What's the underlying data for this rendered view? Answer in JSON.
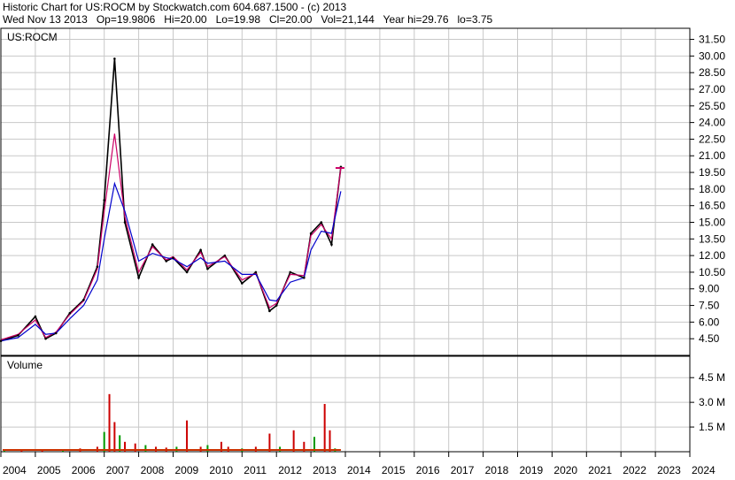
{
  "header": {
    "title_line": "Historic Chart for US:ROCM by Stockwatch.com 604.687.1500 - (c) 2013",
    "stats_line": "Wed Nov 13 2013   Op=19.9806   Hi=20.00   Lo=19.98   Cl=20.00   Vol=21,144   Year hi=29.76   lo=3.75"
  },
  "chart_data": [
    {
      "type": "line",
      "label": "US:ROCM",
      "ylim": [
        3.0,
        32.5
      ],
      "yticks": [
        "31.50",
        "30.00",
        "28.50",
        "27.00",
        "25.50",
        "24.00",
        "22.50",
        "21.00",
        "19.50",
        "18.00",
        "16.50",
        "15.00",
        "13.50",
        "12.00",
        "10.50",
        "9.00",
        "7.50",
        "6.00",
        "4.50"
      ],
      "x": [
        "2004.0",
        "2004.5",
        "2005.0",
        "2005.3",
        "2005.6",
        "2006.0",
        "2006.4",
        "2006.8",
        "2007.0",
        "2007.3",
        "2007.6",
        "2008.0",
        "2008.4",
        "2008.8",
        "2009.0",
        "2009.4",
        "2009.8",
        "2010.0",
        "2010.5",
        "2011.0",
        "2011.4",
        "2011.8",
        "2012.0",
        "2012.4",
        "2012.8",
        "2013.0",
        "2013.3",
        "2013.6",
        "2013.87"
      ],
      "series": [
        {
          "color": "#000000",
          "values": [
            4.3,
            4.8,
            6.5,
            4.5,
            5.0,
            6.8,
            8.0,
            11.0,
            17.0,
            29.76,
            15.0,
            10.0,
            13.0,
            11.5,
            11.8,
            10.5,
            12.5,
            10.8,
            12.0,
            9.5,
            10.5,
            7.0,
            7.5,
            10.5,
            10.0,
            14.0,
            15.0,
            13.0,
            20.0
          ]
        },
        {
          "color": "#cc0066",
          "values": [
            4.4,
            4.9,
            6.2,
            4.6,
            5.1,
            6.7,
            7.9,
            10.8,
            16.0,
            23.0,
            15.5,
            10.5,
            12.8,
            11.6,
            11.9,
            10.7,
            12.3,
            11.0,
            11.9,
            9.8,
            10.4,
            7.3,
            7.7,
            10.3,
            10.2,
            13.8,
            14.8,
            13.5,
            19.9
          ]
        },
        {
          "color": "#0000cc",
          "values": [
            4.3,
            4.6,
            5.8,
            4.9,
            5.0,
            6.3,
            7.5,
            9.8,
            13.5,
            18.5,
            16.0,
            11.5,
            12.2,
            11.8,
            11.7,
            11.0,
            11.8,
            11.3,
            11.5,
            10.3,
            10.3,
            8.0,
            7.9,
            9.6,
            10.0,
            12.5,
            14.2,
            14.0,
            17.8
          ]
        }
      ]
    },
    {
      "type": "bar",
      "label": "Volume",
      "yticks": [
        "4.5 M",
        "3.0 M",
        "1.5 M"
      ],
      "ylim": [
        0,
        5.8
      ],
      "x": [
        "2004.1",
        "2004.6",
        "2005.2",
        "2005.8",
        "2006.3",
        "2006.8",
        "2007.0",
        "2007.15",
        "2007.3",
        "2007.45",
        "2007.6",
        "2007.9",
        "2008.2",
        "2008.5",
        "2008.8",
        "2009.1",
        "2009.4",
        "2009.8",
        "2010.0",
        "2010.4",
        "2010.6",
        "2011.0",
        "2011.4",
        "2011.8",
        "2012.1",
        "2012.5",
        "2012.8",
        "2013.1",
        "2013.4",
        "2013.55",
        "2013.7"
      ],
      "series": [
        {
          "values": [
            0.1,
            0.15,
            0.1,
            0.12,
            0.2,
            0.3,
            1.2,
            3.5,
            1.8,
            1.0,
            0.6,
            0.5,
            0.4,
            0.3,
            0.25,
            0.3,
            1.9,
            0.3,
            0.4,
            0.6,
            0.3,
            0.2,
            0.3,
            1.1,
            0.3,
            1.3,
            0.6,
            0.9,
            2.9,
            1.3,
            0.2
          ]
        }
      ]
    }
  ],
  "x_axis": {
    "labels": [
      "2004",
      "2005",
      "2006",
      "2007",
      "2008",
      "2009",
      "2010",
      "2011",
      "2012",
      "2013",
      "2014",
      "2015",
      "2016",
      "2017",
      "2018",
      "2019",
      "2020",
      "2021",
      "2022",
      "2023",
      "2024"
    ]
  }
}
